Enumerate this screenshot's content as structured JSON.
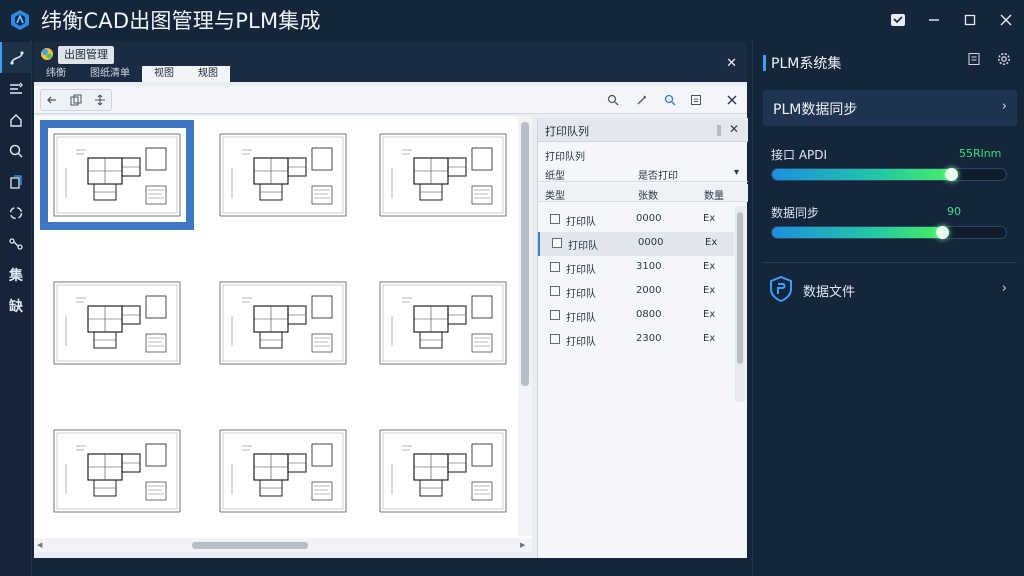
{
  "app": {
    "title": "纬衡CAD出图管理与PLM集成"
  },
  "window_controls": [
    "minimize",
    "restore",
    "close"
  ],
  "left_rail": {
    "icons": [
      "route-icon",
      "layers-icon",
      "home-icon",
      "search-icon",
      "files-icon",
      "sync-icon",
      "share-icon"
    ],
    "text_items": [
      "集",
      "缺"
    ]
  },
  "center": {
    "doc_tab": "出图管理",
    "sub_tabs": [
      "纬衡",
      "图纸清单",
      "视图",
      "规图"
    ],
    "active_sub_tab": 2,
    "close": "✕"
  },
  "queue": {
    "title": "打印队列",
    "subtitle": "打印队列",
    "head1": {
      "col1": "纸型",
      "col2": "是否打印",
      "col3": "▾"
    },
    "head2": {
      "col1": "类型",
      "col2": "张数",
      "col3": "数量"
    },
    "rows": [
      {
        "name": "打印队",
        "num": "0000",
        "flag": "Ex"
      },
      {
        "name": "打印队",
        "num": "0000",
        "flag": "Ex"
      },
      {
        "name": "打印队",
        "num": "3100",
        "flag": "Ex"
      },
      {
        "name": "打印队",
        "num": "2000",
        "flag": "Ex"
      },
      {
        "name": "打印队",
        "num": "0800",
        "flag": "Ex"
      },
      {
        "name": "打印队",
        "num": "2300",
        "flag": "Ex"
      }
    ],
    "selected_row": 1
  },
  "right_panel": {
    "title": "PLM系统集",
    "sync": {
      "label": "PLM数据同步"
    },
    "metrics": [
      {
        "label": "接口 APDI",
        "value": "55Rlnm",
        "progress": 0.77
      },
      {
        "label": "数据同步",
        "value": "90",
        "progress": 0.73
      }
    ],
    "doc_row": {
      "label": "数据文件"
    },
    "accent_color": "#3aa0ff",
    "progress_color": "#47ef63"
  }
}
